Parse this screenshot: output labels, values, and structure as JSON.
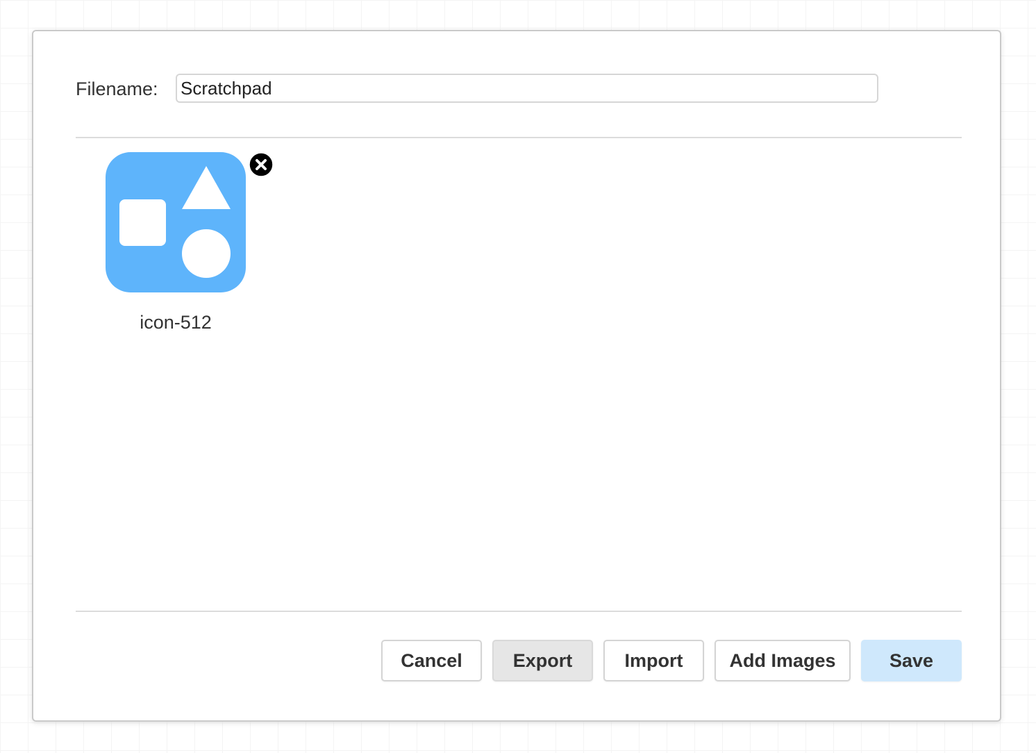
{
  "dialog": {
    "filename_label": "Filename:",
    "filename_value": "Scratchpad"
  },
  "images": [
    {
      "caption": "icon-512",
      "icon": "shapes-icon",
      "background_color": "#5eb4fb",
      "remove_icon": "close-circle-icon"
    }
  ],
  "buttons": {
    "cancel": "Cancel",
    "export": "Export",
    "import": "Import",
    "add_images": "Add Images",
    "save": "Save"
  },
  "colors": {
    "save_button": "#cfe8fc",
    "export_button": "#e6e6e6",
    "tile_blue": "#5eb4fb"
  }
}
